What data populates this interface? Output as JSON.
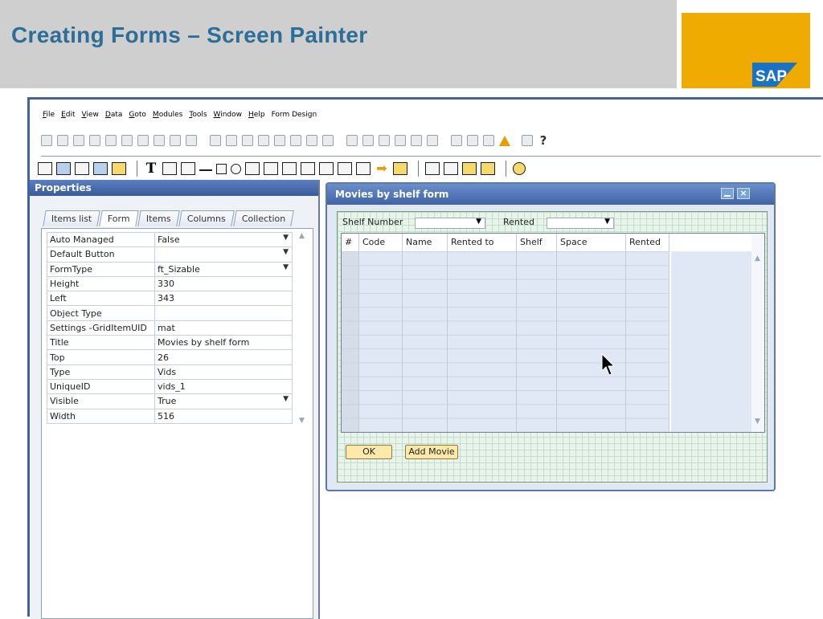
{
  "slide": {
    "title": "Creating Forms – Screen Painter",
    "logo_text": "SAP"
  },
  "menu": [
    {
      "u": "F",
      "rest": "ile"
    },
    {
      "u": "E",
      "rest": "dit"
    },
    {
      "u": "V",
      "rest": "iew"
    },
    {
      "u": "D",
      "rest": "ata"
    },
    {
      "u": "G",
      "rest": "oto"
    },
    {
      "u": "M",
      "rest": "odules"
    },
    {
      "u": "T",
      "rest": "ools"
    },
    {
      "u": "W",
      "rest": "indow"
    },
    {
      "u": "H",
      "rest": "elp"
    },
    {
      "u": "",
      "rest": "Form Design"
    }
  ],
  "toolbar1": {
    "help_label": "?"
  },
  "toolbar2": {
    "text_tool_label": "T"
  },
  "properties": {
    "title": "Properties",
    "tabs": [
      "Items list",
      "Form",
      "Items",
      "Columns",
      "Collection"
    ],
    "active_tab": "Form",
    "rows": [
      {
        "key": "Auto Managed",
        "value": "False",
        "dropdown": true
      },
      {
        "key": "Default Button",
        "value": "",
        "dropdown": true
      },
      {
        "key": "FormType",
        "value": "ft_Sizable",
        "dropdown": true
      },
      {
        "key": "Height",
        "value": "330",
        "dropdown": false
      },
      {
        "key": "Left",
        "value": "343",
        "dropdown": false
      },
      {
        "key": "Object Type",
        "value": "",
        "dropdown": false
      },
      {
        "key": "Settings -GridItemUID",
        "value": "mat",
        "dropdown": false
      },
      {
        "key": "Title",
        "value": "Movies by shelf form",
        "dropdown": false
      },
      {
        "key": "Top",
        "value": "26",
        "dropdown": false
      },
      {
        "key": "Type",
        "value": "Vids",
        "dropdown": false
      },
      {
        "key": "UniqueID",
        "value": "vids_1",
        "dropdown": false
      },
      {
        "key": "Visible",
        "value": "True",
        "dropdown": true
      },
      {
        "key": "Width",
        "value": "516",
        "dropdown": false
      }
    ]
  },
  "form": {
    "title": "Movies by shelf form",
    "shelf_label": "Shelf Number",
    "rented_label": "Rented",
    "columns": [
      "#",
      "Code",
      "Name",
      "Rented to",
      "Shelf",
      "Space",
      "Rented"
    ],
    "ok_label": "OK",
    "add_label": "Add Movie"
  },
  "colors": {
    "title": "#2c6e98",
    "logo": "#f0ab00",
    "window_title": "#3f62a4"
  }
}
